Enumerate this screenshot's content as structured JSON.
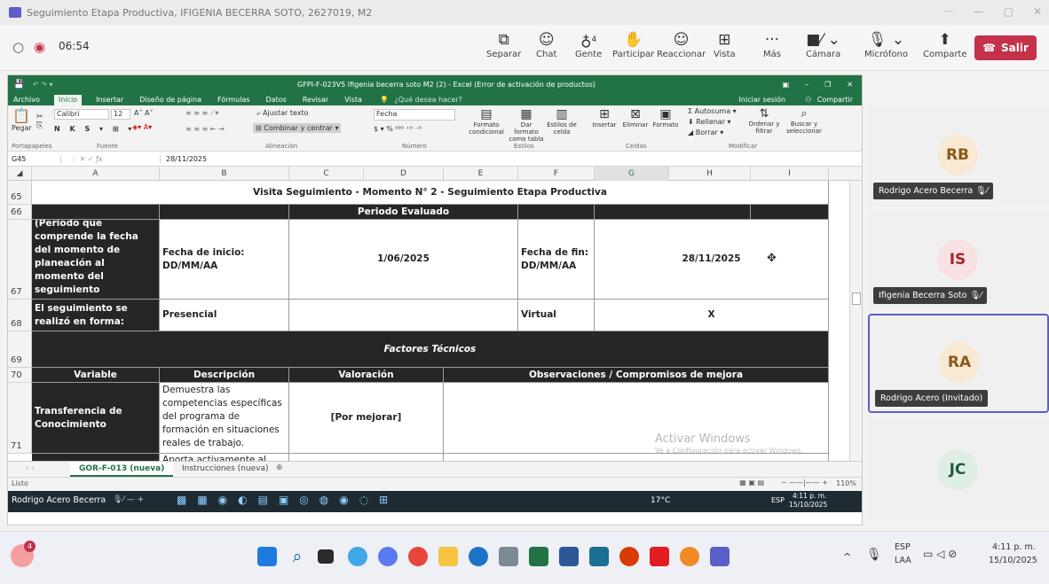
{
  "window": {
    "title": "Seguimiento Etapa Productiva, IFIGENIA BECERRA SOTO, 2627019, M2"
  },
  "meeting": {
    "timer": "06:54",
    "buttons": [
      {
        "label": "Separar",
        "icon": "popout-icon"
      },
      {
        "label": "Chat",
        "icon": "chat-icon"
      },
      {
        "label": "Gente",
        "icon": "people-icon",
        "count": "4"
      },
      {
        "label": "Participar",
        "icon": "raise-hand-icon"
      },
      {
        "label": "Reaccionar",
        "icon": "emoji-icon"
      },
      {
        "label": "Vista",
        "icon": "grid-icon"
      },
      {
        "label": "Más",
        "icon": "more-icon"
      },
      {
        "label": "Cámara",
        "icon": "camera-off-icon"
      },
      {
        "label": "Micrófono",
        "icon": "mic-icon"
      },
      {
        "label": "Comparte",
        "icon": "share-icon"
      }
    ],
    "leave_label": "Salir"
  },
  "excel": {
    "title": "GFPI-F-023V5 Ifigenia becerra soto  M2 (2) - Excel (Error de activación de productos)",
    "tabs": [
      "Archivo",
      "Inicio",
      "Insertar",
      "Diseño de página",
      "Fórmulas",
      "Datos",
      "Revisar",
      "Vista"
    ],
    "active_tab": "Inicio",
    "tell_me": "¿Qué desea hacer?",
    "signin": "Iniciar sesión",
    "share": "Compartir",
    "ribbon": {
      "paste": "Pegar",
      "font_name": "Calibri",
      "font_size": "12",
      "wrap_text": "Ajustar texto",
      "merge_center": "Combinar y centrar",
      "number_format": "Fecha",
      "conditional": "Formato condicional",
      "as_table": "Dar formato como tabla",
      "cell_styles": "Estilos de celda",
      "insert": "Insertar",
      "delete": "Eliminar",
      "format": "Formato",
      "autosum": "Autosuma",
      "fill": "Rellenar",
      "clear": "Borrar",
      "sort_filter": "Ordenar y filtrar",
      "find_select": "Buscar y seleccionar",
      "groups": [
        "Portapapeles",
        "Fuente",
        "Alineación",
        "Número",
        "Estilos",
        "Celdas",
        "Modificar"
      ]
    },
    "name_box": "G45",
    "formula_value": "28/11/2025",
    "columns": [
      "A",
      "B",
      "C",
      "D",
      "E",
      "F",
      "G",
      "H",
      "I"
    ],
    "rows": [
      "65",
      "66",
      "67",
      "68",
      "69",
      "70",
      "71"
    ],
    "sheet": {
      "banner": "Visita Seguimiento - Momento N° 2 - Seguimiento Etapa Productiva",
      "periodo_header": "Periodo Evaluado",
      "periodo_label": "Periodo Evaluado: (Periodo que comprende la fecha del momento de planeación al momento del seguimiento",
      "fecha_inicio_label": "Fecha de inicio: DD/MM/AA",
      "fecha_inicio": "1/06/2025",
      "fecha_fin_label": "Fecha de fin: DD/MM/AA",
      "fecha_fin": "28/11/2025",
      "forma_label": "El seguimiento se realizó en forma:",
      "presencial": "Presencial",
      "virtual": "Virtual",
      "virtual_mark": "X",
      "factores": "Factores Técnicos",
      "h_variable": "Variable",
      "h_descripcion": "Descripción",
      "h_valoracion": "Valoración",
      "h_observaciones": "Observaciones / Compromisos de mejora",
      "var1": "Transferencia de Conocimiento",
      "desc1": "Demuestra las competencias específicas del programa de formación en situaciones reales de trabajo.",
      "val1": "[Por mejorar]",
      "desc2": "Aporta activamente al"
    },
    "sheet_tabs": [
      "GOR-F-013 (nueva)",
      "Instrucciones (nueva)"
    ],
    "status": "Listo",
    "zoom": "110%",
    "watermark_title": "Activar Windows",
    "watermark_sub": "Ve a Configuración para activar Windows.",
    "inner_taskbar": {
      "speaker": "Rodrigo Acero Becerra",
      "temp": "17°C",
      "lang": "ESP",
      "time": "4:11 p. m.",
      "date": "15/10/2025"
    }
  },
  "participants": [
    {
      "initials": "RB",
      "name": "Rodrigo Acero Becerra",
      "bg": "#f8e9d4",
      "fg": "#8a5a19"
    },
    {
      "initials": "IS",
      "name": "Ifigenia Becerra Soto",
      "bg": "#f8e1e2",
      "fg": "#a4262c"
    },
    {
      "initials": "RA",
      "name": "Rodrigo Acero (Invitado)",
      "bg": "#f8e9d4",
      "fg": "#8a5a19"
    },
    {
      "initials": "JC",
      "name": "",
      "bg": "#dfeee5",
      "fg": "#1e5c3a"
    }
  ],
  "taskbar": {
    "lang_top": "ESP",
    "lang_bottom": "LAA",
    "time": "4:11 p. m.",
    "date": "15/10/2025",
    "notification_count": "4"
  },
  "colors": {
    "excel_green": "#217346",
    "teams_purple": "#5b5fc7",
    "leave_red": "#c4314b",
    "dark_fill": "#262626"
  }
}
